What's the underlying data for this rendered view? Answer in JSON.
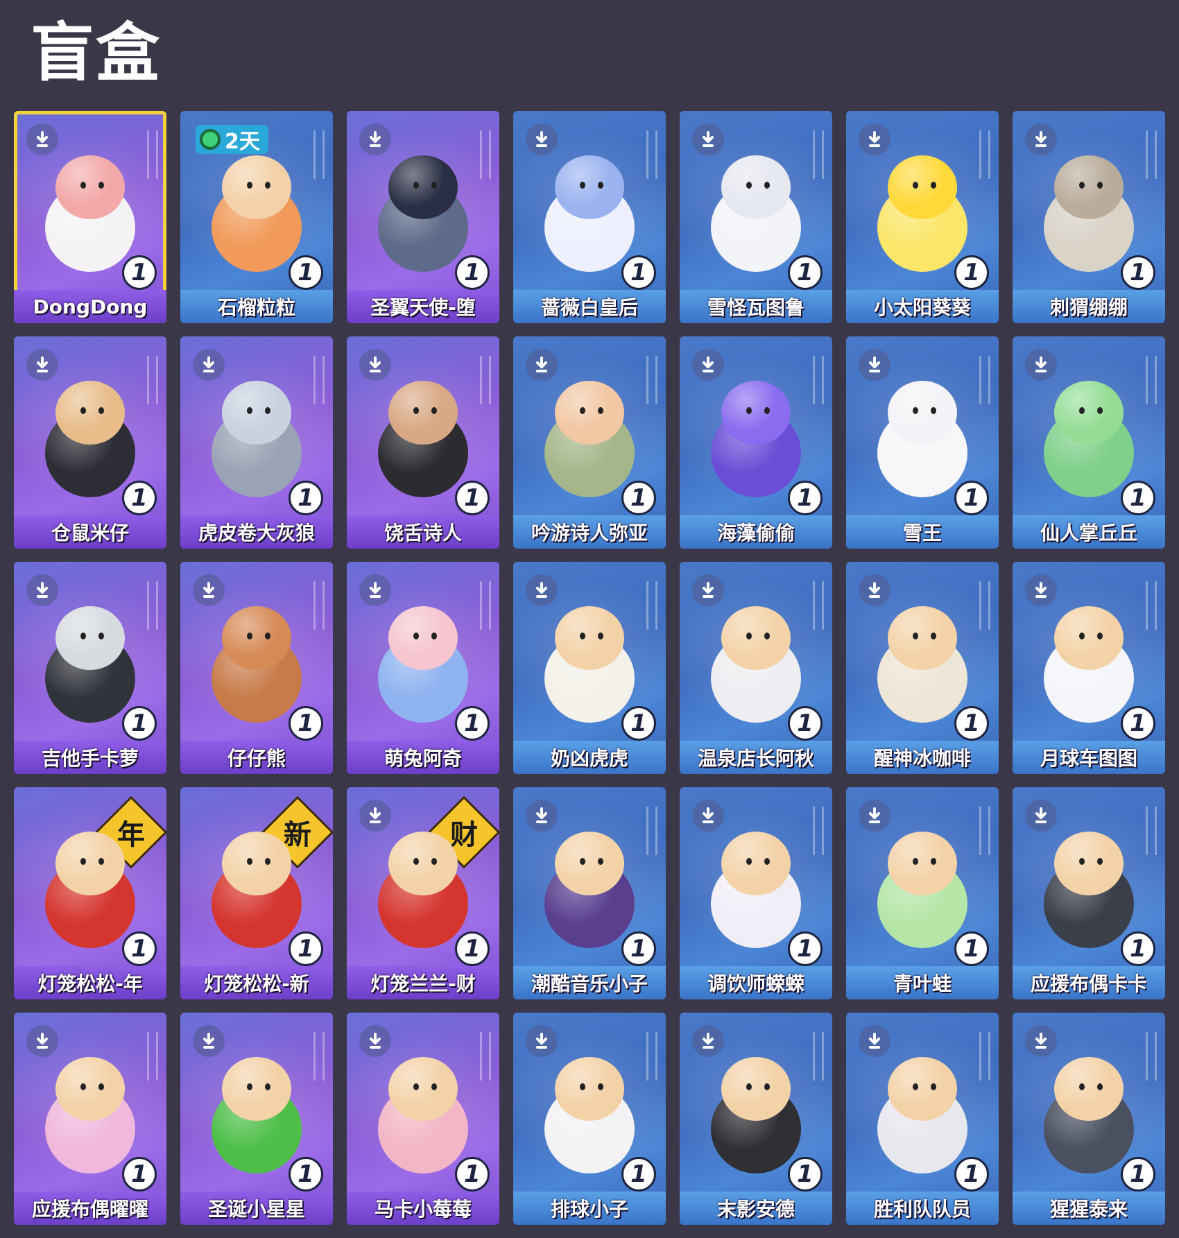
{
  "page": {
    "title": "盲盒"
  },
  "colors": {
    "background": "#3a3749",
    "selected_outline": "#f2d43a",
    "count_badge": "#ffffff"
  },
  "cards": [
    {
      "name": "DongDong",
      "count": "1",
      "theme": "purple",
      "selected": true,
      "download": true,
      "body": "#f6f3f7",
      "head": "#f2a8a8"
    },
    {
      "name": "石榴粒粒",
      "count": "1",
      "theme": "blue",
      "timer": "2天",
      "download": false,
      "body": "#f19a5a",
      "head": "#f4d1a8"
    },
    {
      "name": "圣翼天使-堕",
      "count": "1",
      "theme": "purple",
      "download": true,
      "body": "#5d6a8a",
      "head": "#2b2f45"
    },
    {
      "name": "蔷薇白皇后",
      "count": "1",
      "theme": "blue",
      "download": true,
      "body": "#eef0ff",
      "head": "#9ab3f0"
    },
    {
      "name": "雪怪瓦图鲁",
      "count": "1",
      "theme": "blue",
      "download": true,
      "body": "#f3f4f8",
      "head": "#e6e8f0"
    },
    {
      "name": "小太阳葵葵",
      "count": "1",
      "theme": "blue",
      "download": true,
      "body": "#fbe66a",
      "head": "#ffd93a"
    },
    {
      "name": "刺猬绷绷",
      "count": "1",
      "theme": "blue",
      "download": true,
      "body": "#d9d3c8",
      "head": "#b9ac9a"
    },
    {
      "name": "仓鼠米仔",
      "count": "1",
      "theme": "purple",
      "download": true,
      "body": "#2d2d36",
      "head": "#e8bd8a"
    },
    {
      "name": "虎皮卷大灰狼",
      "count": "1",
      "theme": "purple",
      "download": true,
      "body": "#9aa3b5",
      "head": "#c9d2e0"
    },
    {
      "name": "饶舌诗人",
      "count": "1",
      "theme": "purple",
      "download": true,
      "body": "#2b2b30",
      "head": "#d9a884"
    },
    {
      "name": "吟游诗人弥亚",
      "count": "1",
      "theme": "blue",
      "download": true,
      "body": "#a5b78a",
      "head": "#f2c7a3"
    },
    {
      "name": "海藻偷偷",
      "count": "1",
      "theme": "blue",
      "download": true,
      "body": "#6a4fd6",
      "head": "#8a6cf0"
    },
    {
      "name": "雪王",
      "count": "1",
      "theme": "blue",
      "download": true,
      "body": "#f7f7fa",
      "head": "#f4f4f8"
    },
    {
      "name": "仙人掌丘丘",
      "count": "1",
      "theme": "blue",
      "download": true,
      "body": "#7fd08a",
      "head": "#95dd96"
    },
    {
      "name": "吉他手卡萝",
      "count": "1",
      "theme": "purple",
      "download": true,
      "body": "#30333a",
      "head": "#d7dbe0"
    },
    {
      "name": "仔仔熊",
      "count": "1",
      "theme": "purple",
      "download": true,
      "body": "#c87b4a",
      "head": "#d68a56"
    },
    {
      "name": "萌兔阿奇",
      "count": "1",
      "theme": "purple",
      "download": true,
      "body": "#8fb3f0",
      "head": "#f6c5cf"
    },
    {
      "name": "奶凶虎虎",
      "count": "1",
      "theme": "blue",
      "download": true,
      "body": "#f4f1ea",
      "head": "#f4d2a8"
    },
    {
      "name": "温泉店长阿秋",
      "count": "1",
      "theme": "blue",
      "download": true,
      "body": "#eeeef2",
      "head": "#f4d2a8"
    },
    {
      "name": "醒神冰咖啡",
      "count": "1",
      "theme": "blue",
      "download": true,
      "body": "#eee6d6",
      "head": "#f4d2a8"
    },
    {
      "name": "月球车图图",
      "count": "1",
      "theme": "blue",
      "download": true,
      "body": "#f4f6fc",
      "head": "#f4d2a8"
    },
    {
      "name": "灯笼松松-年",
      "count": "1",
      "theme": "purple",
      "badge": "年",
      "download": false,
      "body": "#d5352f",
      "head": "#f4d2a8"
    },
    {
      "name": "灯笼松松-新",
      "count": "1",
      "theme": "purple",
      "badge": "新",
      "download": false,
      "body": "#d5352f",
      "head": "#f4d2a8"
    },
    {
      "name": "灯笼兰兰-财",
      "count": "1",
      "theme": "purple",
      "badge": "财",
      "download": true,
      "body": "#d5352f",
      "head": "#f4d2a8"
    },
    {
      "name": "潮酷音乐小子",
      "count": "1",
      "theme": "blue",
      "download": true,
      "body": "#5a3f8f",
      "head": "#f4d2a8"
    },
    {
      "name": "调饮师蝾蝾",
      "count": "1",
      "theme": "blue",
      "download": true,
      "body": "#f2eef8",
      "head": "#f4d2a8"
    },
    {
      "name": "青叶蛙",
      "count": "1",
      "theme": "blue",
      "download": true,
      "body": "#b5e6a8",
      "head": "#f4d2a8"
    },
    {
      "name": "应援布偶卡卡",
      "count": "1",
      "theme": "blue",
      "download": true,
      "body": "#3b3f4a",
      "head": "#f4d2a8"
    },
    {
      "name": "应援布偶曜曜",
      "count": "1",
      "theme": "purple",
      "download": true,
      "body": "#f0b8dc",
      "head": "#f4d2a8"
    },
    {
      "name": "圣诞小星星",
      "count": "1",
      "theme": "purple",
      "download": true,
      "body": "#4fbf4a",
      "head": "#f4d2a8"
    },
    {
      "name": "马卡小莓莓",
      "count": "1",
      "theme": "purple",
      "download": true,
      "body": "#f3b6c6",
      "head": "#f4d2a8"
    },
    {
      "name": "排球小子",
      "count": "1",
      "theme": "blue",
      "download": true,
      "body": "#f3f3f6",
      "head": "#f4d2a8"
    },
    {
      "name": "末影安德",
      "count": "1",
      "theme": "blue",
      "download": true,
      "body": "#2f2f34",
      "head": "#f4d2a8"
    },
    {
      "name": "胜利队队员",
      "count": "1",
      "theme": "blue",
      "download": true,
      "body": "#e7e7ee",
      "head": "#f4d2a8"
    },
    {
      "name": "猩猩泰来",
      "count": "1",
      "theme": "blue",
      "download": true,
      "body": "#4a5060",
      "head": "#f4d2a8"
    }
  ]
}
